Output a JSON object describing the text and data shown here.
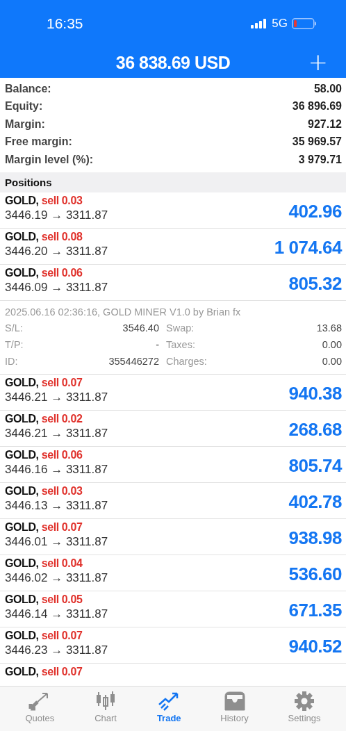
{
  "status_bar": {
    "time": "16:35",
    "network": "5G"
  },
  "header": {
    "title": "36 838.69 USD",
    "action": "+"
  },
  "summary": [
    {
      "label": "Balance:",
      "value": "58.00"
    },
    {
      "label": "Equity:",
      "value": "36 896.69"
    },
    {
      "label": "Margin:",
      "value": "927.12"
    },
    {
      "label": "Free margin:",
      "value": "35 969.57"
    },
    {
      "label": "Margin level (%):",
      "value": "3 979.71"
    }
  ],
  "positions_heading": "Positions",
  "positions": [
    {
      "symbol": "GOLD,",
      "side": "sell 0.03",
      "prices": "3446.19 → 3311.87",
      "profit": "402.96"
    },
    {
      "symbol": "GOLD,",
      "side": "sell 0.08",
      "prices": "3446.20 → 3311.87",
      "profit": "1 074.64"
    },
    {
      "symbol": "GOLD,",
      "side": "sell 0.06",
      "prices": "3446.09 → 3311.87",
      "profit": "805.32",
      "details": {
        "comment": "2025.06.16 02:36:16, GOLD MINER V1.0 by Brian fx",
        "left": [
          {
            "label": "S/L:",
            "value": "3546.40"
          },
          {
            "label": "T/P:",
            "value": "-"
          },
          {
            "label": "ID:",
            "value": "355446272"
          }
        ],
        "right": [
          {
            "label": "Swap:",
            "value": "13.68"
          },
          {
            "label": "Taxes:",
            "value": "0.00"
          },
          {
            "label": "Charges:",
            "value": "0.00"
          }
        ]
      }
    },
    {
      "symbol": "GOLD,",
      "side": "sell 0.07",
      "prices": "3446.21 → 3311.87",
      "profit": "940.38"
    },
    {
      "symbol": "GOLD,",
      "side": "sell 0.02",
      "prices": "3446.21 → 3311.87",
      "profit": "268.68"
    },
    {
      "symbol": "GOLD,",
      "side": "sell 0.06",
      "prices": "3446.16 → 3311.87",
      "profit": "805.74"
    },
    {
      "symbol": "GOLD,",
      "side": "sell 0.03",
      "prices": "3446.13 → 3311.87",
      "profit": "402.78"
    },
    {
      "symbol": "GOLD,",
      "side": "sell 0.07",
      "prices": "3446.01 → 3311.87",
      "profit": "938.98"
    },
    {
      "symbol": "GOLD,",
      "side": "sell 0.04",
      "prices": "3446.02 → 3311.87",
      "profit": "536.60"
    },
    {
      "symbol": "GOLD,",
      "side": "sell 0.05",
      "prices": "3446.14 → 3311.87",
      "profit": "671.35"
    },
    {
      "symbol": "GOLD,",
      "side": "sell 0.07",
      "prices": "3446.23 → 3311.87",
      "profit": "940.52"
    },
    {
      "symbol": "GOLD,",
      "side": "sell 0.07"
    }
  ],
  "tabs": [
    {
      "label": "Quotes",
      "kind": "quotes",
      "selected": false
    },
    {
      "label": "Chart",
      "kind": "chart",
      "selected": false
    },
    {
      "label": "Trade",
      "kind": "trade",
      "selected": true
    },
    {
      "label": "History",
      "kind": "history",
      "selected": false
    },
    {
      "label": "Settings",
      "kind": "settings",
      "selected": false
    }
  ]
}
